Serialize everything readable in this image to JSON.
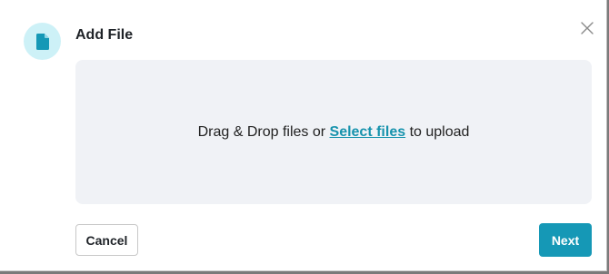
{
  "dialog": {
    "title": "Add File",
    "icon": "file-icon",
    "close_icon": "close-icon"
  },
  "dropzone": {
    "text_before": "Drag & Drop files or ",
    "link_label": "Select files",
    "text_after": " to upload"
  },
  "footer": {
    "cancel_label": "Cancel",
    "next_label": "Next"
  },
  "colors": {
    "accent": "#1598b6",
    "link": "#1793ad",
    "icon_bg": "#cdf1f7",
    "dropzone_bg": "#f0f2f6"
  }
}
